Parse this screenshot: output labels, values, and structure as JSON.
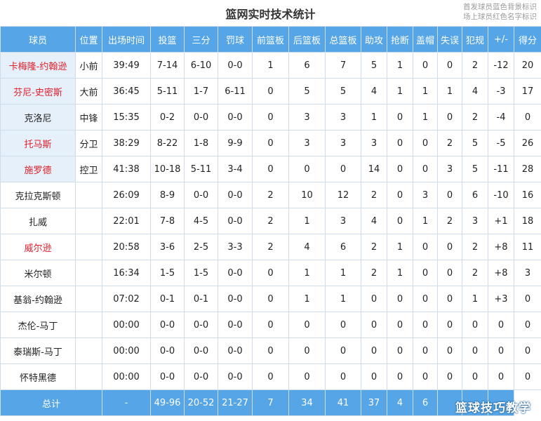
{
  "title": "篮网实时技术统计",
  "legend": [
    "首发球员蓝色背景标识",
    "场上球员红色名字标识"
  ],
  "watermark": "篮球技巧教学",
  "colors": {
    "header_bg": "#56a5e6",
    "starter_bg": "#e6f0fb",
    "oncourt_name": "#e0202a"
  },
  "columns": [
    "球员",
    "位置",
    "出场时间",
    "投篮",
    "三分",
    "罚球",
    "前篮板",
    "后篮板",
    "总篮板",
    "助攻",
    "抢断",
    "盖帽",
    "失误",
    "犯规",
    "+/-",
    "得分"
  ],
  "players": [
    {
      "name": "卡梅隆-约翰逊",
      "pos": "小前",
      "starter": true,
      "oncourt": true,
      "cells": [
        "39:49",
        "7-14",
        "6-10",
        "0-0",
        "1",
        "6",
        "7",
        "5",
        "1",
        "0",
        "0",
        "2",
        "-12",
        "20"
      ]
    },
    {
      "name": "芬尼-史密斯",
      "pos": "大前",
      "starter": true,
      "oncourt": true,
      "cells": [
        "36:45",
        "5-11",
        "1-7",
        "6-11",
        "0",
        "5",
        "5",
        "4",
        "1",
        "1",
        "1",
        "4",
        "-3",
        "17"
      ]
    },
    {
      "name": "克洛尼",
      "pos": "中锋",
      "starter": true,
      "oncourt": false,
      "cells": [
        "15:35",
        "0-2",
        "0-0",
        "0-0",
        "0",
        "3",
        "3",
        "1",
        "0",
        "1",
        "0",
        "2",
        "-4",
        "0"
      ]
    },
    {
      "name": "托马斯",
      "pos": "分卫",
      "starter": true,
      "oncourt": true,
      "cells": [
        "38:29",
        "8-22",
        "1-8",
        "9-9",
        "0",
        "3",
        "3",
        "3",
        "0",
        "0",
        "2",
        "5",
        "-5",
        "26"
      ]
    },
    {
      "name": "施罗德",
      "pos": "控卫",
      "starter": true,
      "oncourt": true,
      "cells": [
        "41:38",
        "10-18",
        "5-11",
        "3-4",
        "0",
        "0",
        "0",
        "14",
        "0",
        "0",
        "3",
        "5",
        "-11",
        "28"
      ]
    },
    {
      "name": "克拉克斯顿",
      "pos": "",
      "starter": false,
      "oncourt": false,
      "cells": [
        "26:09",
        "8-9",
        "0-0",
        "0-0",
        "2",
        "10",
        "12",
        "2",
        "0",
        "3",
        "0",
        "6",
        "-10",
        "16"
      ]
    },
    {
      "name": "扎威",
      "pos": "",
      "starter": false,
      "oncourt": false,
      "cells": [
        "22:01",
        "7-8",
        "4-5",
        "0-0",
        "2",
        "1",
        "3",
        "4",
        "0",
        "1",
        "2",
        "3",
        "+1",
        "18"
      ]
    },
    {
      "name": "威尔逊",
      "pos": "",
      "starter": false,
      "oncourt": true,
      "cells": [
        "20:58",
        "3-6",
        "2-5",
        "3-3",
        "2",
        "4",
        "6",
        "2",
        "1",
        "0",
        "0",
        "2",
        "+8",
        "11"
      ]
    },
    {
      "name": "米尔顿",
      "pos": "",
      "starter": false,
      "oncourt": false,
      "cells": [
        "16:34",
        "1-5",
        "1-5",
        "0-0",
        "0",
        "1",
        "1",
        "2",
        "1",
        "0",
        "0",
        "2",
        "+8",
        "3"
      ]
    },
    {
      "name": "基翁-约翰逊",
      "pos": "",
      "starter": false,
      "oncourt": false,
      "cells": [
        "07:02",
        "0-1",
        "0-1",
        "0-0",
        "0",
        "1",
        "1",
        "0",
        "0",
        "0",
        "0",
        "1",
        "+3",
        "0"
      ]
    },
    {
      "name": "杰伦-马丁",
      "pos": "",
      "starter": false,
      "oncourt": false,
      "cells": [
        "00:00",
        "0-0",
        "0-0",
        "0-0",
        "0",
        "0",
        "0",
        "0",
        "0",
        "0",
        "0",
        "0",
        "0",
        "0"
      ]
    },
    {
      "name": "泰瑞斯-马丁",
      "pos": "",
      "starter": false,
      "oncourt": false,
      "cells": [
        "00:00",
        "0-0",
        "0-0",
        "0-0",
        "0",
        "0",
        "0",
        "0",
        "0",
        "0",
        "0",
        "0",
        "0",
        "0"
      ]
    },
    {
      "name": "怀特黑德",
      "pos": "",
      "starter": false,
      "oncourt": false,
      "cells": [
        "00:00",
        "0-0",
        "0-0",
        "0-0",
        "0",
        "0",
        "0",
        "0",
        "0",
        "0",
        "0",
        "0",
        "0",
        "0"
      ]
    }
  ],
  "totals": {
    "label": "总计",
    "cells": [
      "-",
      "49-96",
      "20-52",
      "21-27",
      "7",
      "34",
      "41",
      "37",
      "4",
      "6",
      "",
      "",
      ""
    ]
  }
}
